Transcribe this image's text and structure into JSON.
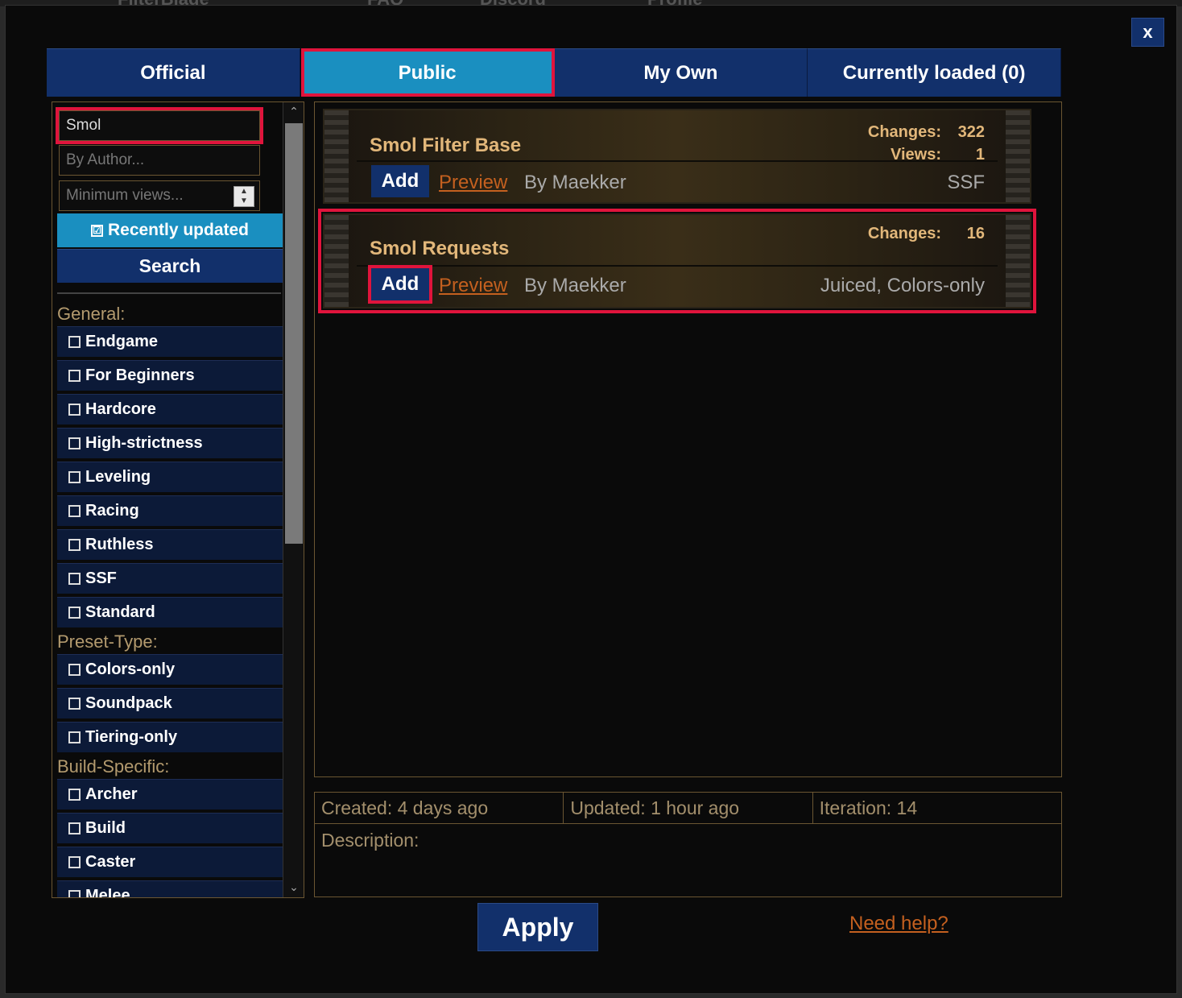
{
  "top_nav_fragments": [
    "FilterBlade",
    "FAQ",
    "Discord",
    "Profile"
  ],
  "close_label": "x",
  "tabs": [
    {
      "label": "Official",
      "active": false
    },
    {
      "label": "Public",
      "active": true
    },
    {
      "label": "My Own",
      "active": false
    },
    {
      "label": "Currently loaded (0)",
      "active": false
    }
  ],
  "filters": {
    "search_value": "Smol",
    "author_placeholder": "By Author...",
    "views_placeholder": "Minimum views...",
    "recently_updated_label": "Recently updated",
    "recently_updated_checked": true,
    "checkmark": "☑",
    "search_button": "Search"
  },
  "sections": [
    {
      "title": "General:",
      "items": [
        "Endgame",
        "For Beginners",
        "Hardcore",
        "High-strictness",
        "Leveling",
        "Racing",
        "Ruthless",
        "SSF",
        "Standard"
      ]
    },
    {
      "title": "Preset-Type:",
      "items": [
        "Colors-only",
        "Soundpack",
        "Tiering-only"
      ]
    },
    {
      "title": "Build-Specific:",
      "items": [
        "Archer",
        "Build",
        "Caster",
        "Melee"
      ]
    }
  ],
  "results": [
    {
      "title": "Smol Filter Base",
      "changes_label": "Changes:",
      "changes": "322",
      "views_label": "Views:",
      "views": "1",
      "add_label": "Add",
      "preview_label": "Preview",
      "author": "By Maekker",
      "tags": "SSF"
    },
    {
      "title": "Smol Requests",
      "changes_label": "Changes:",
      "changes": "16",
      "add_label": "Add",
      "preview_label": "Preview",
      "author": "By Maekker",
      "tags": "Juiced, Colors-only"
    }
  ],
  "info": {
    "created": "Created: 4 days ago",
    "updated": "Updated: 1 hour ago",
    "iteration": "Iteration: 14",
    "description_label": "Description:"
  },
  "apply_label": "Apply",
  "help_label": "Need help?",
  "colors": {
    "accent_blue": "#12306b",
    "active_tab": "#1a8fc0",
    "highlight_red": "#e0143c",
    "gold_text": "#e2b77a",
    "link_orange": "#c4601f"
  }
}
